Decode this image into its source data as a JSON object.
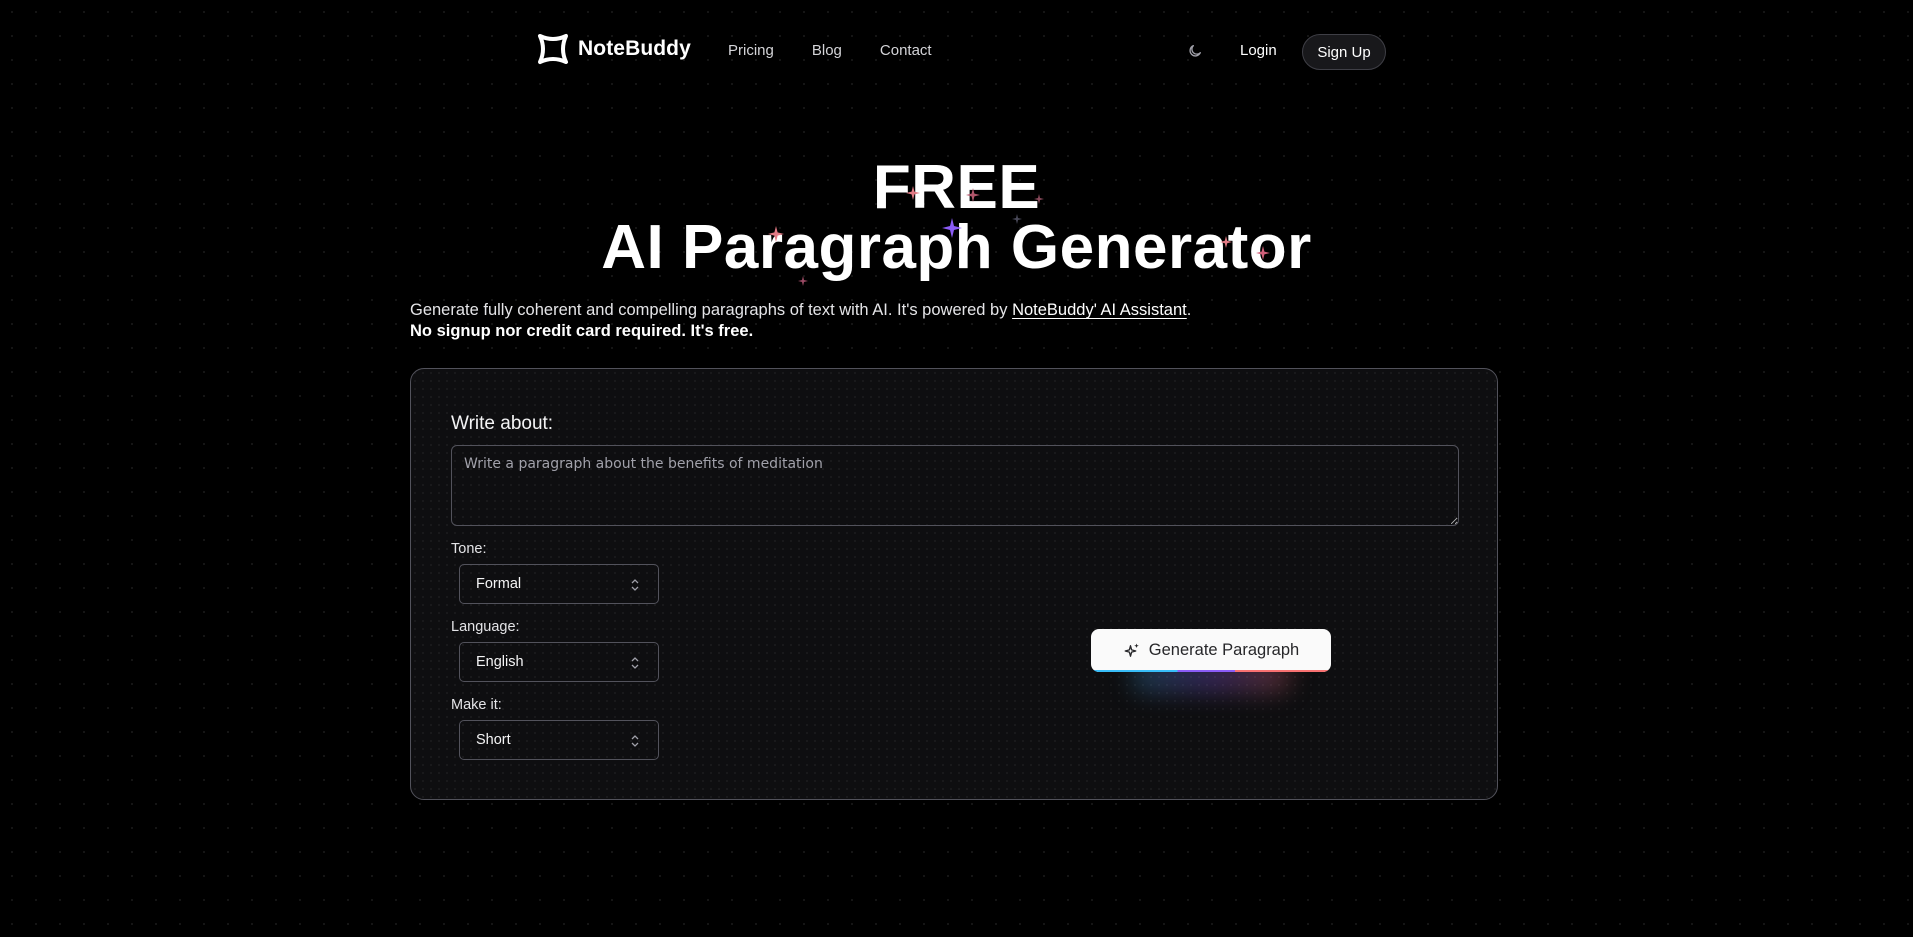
{
  "nav": {
    "brand": "NoteBuddy",
    "links": [
      "Pricing",
      "Blog",
      "Contact"
    ],
    "theme_icon": "moon-icon",
    "login": "Login",
    "signup": "Sign Up"
  },
  "hero": {
    "title_line1": "FREE",
    "title_line2": "AI Paragraph Generator",
    "subtitle_prefix": "Generate fully coherent and compelling paragraphs of text with AI. It's powered by ",
    "subtitle_link": "NoteBuddy' AI Assistant",
    "subtitle_suffix": ".",
    "subtitle_bold": "No signup nor credit card required. It's free."
  },
  "form": {
    "write_label": "Write about:",
    "prompt_placeholder": "Write a paragraph about the benefits of meditation",
    "prompt_value": "",
    "tone_label": "Tone:",
    "tone_value": "Formal",
    "language_label": "Language:",
    "language_value": "English",
    "length_label": "Make it:",
    "length_value": "Short",
    "generate_label": "Generate Paragraph",
    "generate_icon": "sparkles-icon"
  },
  "colors": {
    "background": "#000000",
    "card": "#0e0e10",
    "border": "#52525b",
    "sparkle_pink": "#e17a84",
    "sparkle_purple": "#8b5cf6",
    "button_bg": "#fafafa"
  }
}
